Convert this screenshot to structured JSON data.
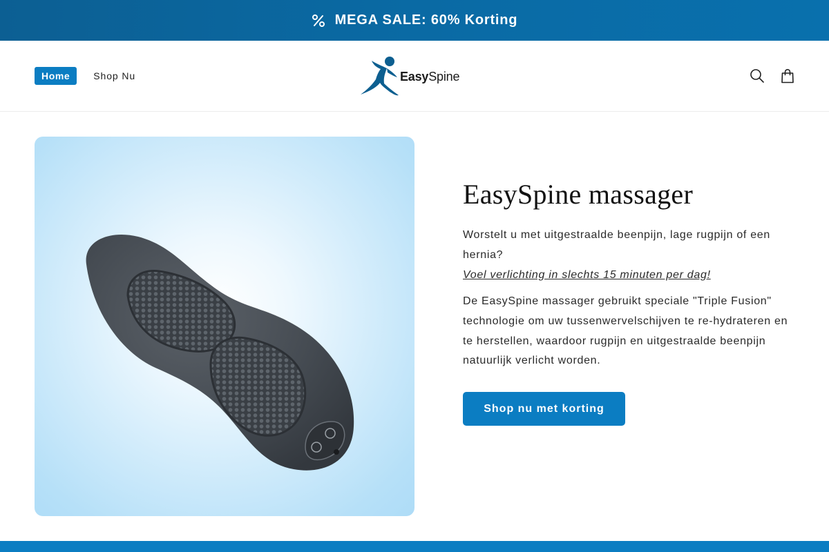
{
  "announcement": {
    "icon": "percent-icon",
    "text": "MEGA SALE: 60% Korting"
  },
  "header": {
    "nav": {
      "home_label": "Home",
      "shop_label": "Shop Nu"
    },
    "logo": {
      "text_bold": "Easy",
      "text_regular": "Spine"
    },
    "icons": [
      "search-icon",
      "cart-icon"
    ]
  },
  "hero": {
    "image_icon": "massager-product-image",
    "title": "EasySpine massager",
    "intro": "Worstelt u met uitgestraalde beenpijn, lage rugpijn of een hernia?",
    "link_text": "Voel verlichting in slechts 15 minuten per dag!",
    "description": "De EasySpine massager gebruikt speciale \"Triple Fusion\" technologie om uw tussenwervelschijven te re-hydrateren en te herstellen, waardoor rugpijn en uitgestraalde beenpijn natuurlijk verlicht worden.",
    "cta_label": "Shop nu met korting"
  },
  "colors": {
    "brand_blue": "#0b7dc2",
    "announcement_bg": "#0a6aa4",
    "hero_bg": "#b6e0f8",
    "text_dark": "#121212"
  }
}
